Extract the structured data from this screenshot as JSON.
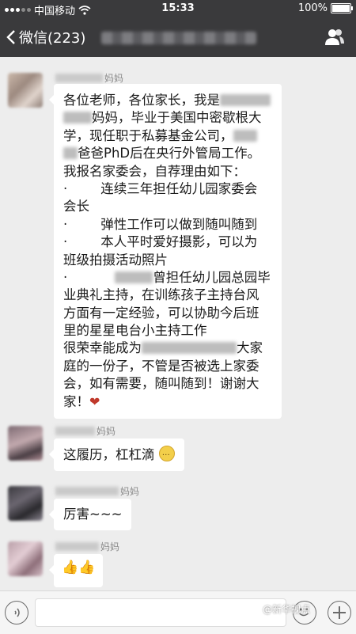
{
  "status_bar": {
    "carrier": "中国移动",
    "time": "15:33",
    "battery": "100%"
  },
  "nav": {
    "back_label": "微信(223)"
  },
  "messages": [
    {
      "sender_suffix": "妈妈",
      "lines": [
        [
          "各位老师，各位家长，我是",
          "[blur]",
          ""
        ],
        [
          "",
          "[blur]",
          "妈妈，毕业于美国中密歇根大"
        ],
        [
          "学，现任职于私募基金公司，",
          "[blur]",
          ""
        ],
        [
          "",
          "[blur]",
          "爸爸PhD后在央行外管局工作。"
        ],
        [
          "我报名家委会，自荐理由如下：",
          "",
          ""
        ],
        [
          "·        连续三年担任幼儿园家委会",
          "",
          ""
        ],
        [
          "会长",
          "",
          ""
        ],
        [
          "·        弹性工作可以做到随叫随到",
          "",
          ""
        ],
        [
          "·        本人平时爱好摄影，可以为",
          "",
          ""
        ],
        [
          "班级拍摄活动照片",
          "",
          ""
        ],
        [
          "·",
          "[blur]",
          "曾担任幼儿园总园毕"
        ],
        [
          "业典礼主持，在训练孩子主持台风",
          "",
          ""
        ],
        [
          "方面有一定经验，可以协助今后班",
          "",
          ""
        ],
        [
          "里的星星电台小主持工作",
          "",
          ""
        ],
        [
          "很荣幸能成为",
          "[blur]",
          "大家"
        ],
        [
          "庭的一份子，不管是否被选上家委",
          "",
          ""
        ],
        [
          "会，如有需要，随叫随到！谢谢大",
          "",
          ""
        ],
        [
          "家！",
          "",
          ""
        ]
      ]
    },
    {
      "sender_suffix": "妈妈",
      "text": "这履历，杠杠滴"
    },
    {
      "sender_suffix": "妈妈",
      "text": "厉害~~~"
    },
    {
      "sender_suffix": "妈妈",
      "text": ""
    }
  ],
  "watermark": "@新华视点",
  "colors": {
    "nav_bg": "#3a3a3c",
    "chat_bg": "#ededed",
    "bubble_bg": "#ffffff"
  },
  "icons": [
    "wifi-icon",
    "back-chevron-icon",
    "group-members-icon",
    "voice-icon",
    "emoji-icon",
    "plus-icon",
    "heart-icon",
    "thumbs-up-icon"
  ]
}
